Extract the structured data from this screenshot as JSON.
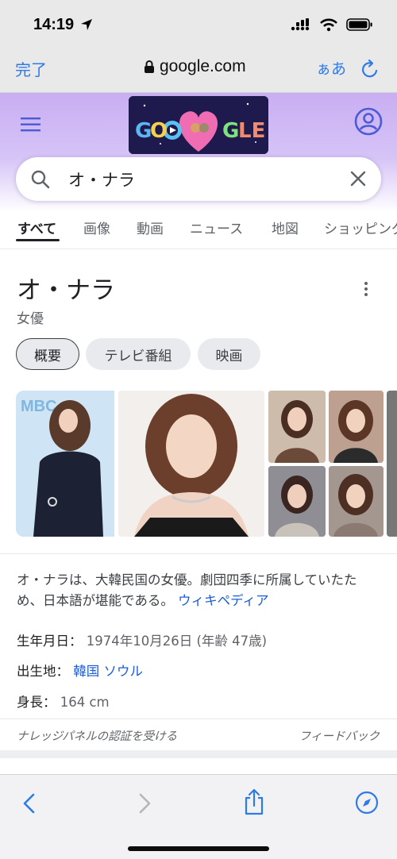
{
  "status_bar": {
    "time": "14:19"
  },
  "safari": {
    "done_label": "完了",
    "url": "google.com",
    "text_size_label": "ぁあ"
  },
  "search": {
    "query": "オ・ナラ"
  },
  "tabs": [
    "すべて",
    "画像",
    "動画",
    "ニュース",
    "地図",
    "ショッピング"
  ],
  "knowledge_panel": {
    "title": "オ・ナラ",
    "subtitle": "女優",
    "chips": [
      "概要",
      "テレビ番組",
      "映画"
    ],
    "description": "オ・ナラは、大韓民国の女優。劇団四季に所属していたため、日本語が堪能である。",
    "source_link": "ウィキペディア",
    "facts": {
      "birth_label": "生年月日：",
      "birth_value": "1974年10月26日 (年齢 47歳)",
      "birthplace_label": "出生地：",
      "birthplace_country": "韓国",
      "birthplace_city": "ソウル",
      "height_label": "身長：",
      "height_value": "164 cm"
    },
    "claim_label": "ナレッジパネルの認証を受ける",
    "feedback_label": "フィードバック"
  },
  "doodle": {
    "letters": "GO  GLE"
  },
  "colors": {
    "accent": "#2f7be5",
    "header_bg": "#c9aef2",
    "link": "#1a5cd8"
  }
}
